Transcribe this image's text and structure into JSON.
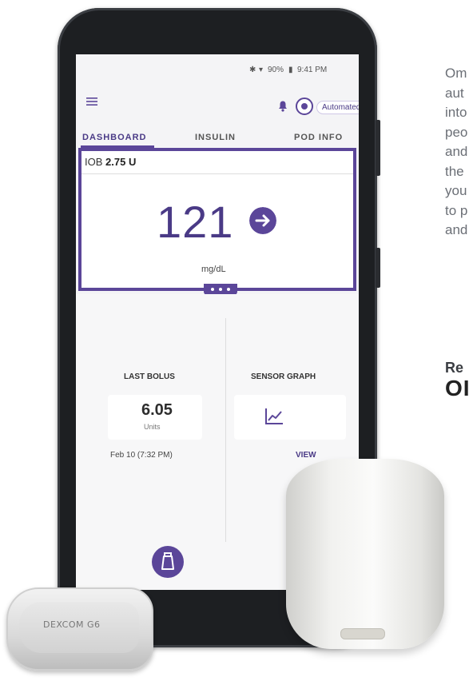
{
  "article": {
    "lines": [
      "Om",
      "aut",
      "into",
      "peo",
      "and",
      "the",
      "you",
      "to p",
      "and"
    ],
    "subheading": "Re",
    "big_heading": "OI"
  },
  "status_bar": {
    "battery": "90%",
    "time": "9:41 PM"
  },
  "app_bar": {
    "mode_label": "Automated"
  },
  "tabs": [
    {
      "label": "DASHBOARD",
      "active": true
    },
    {
      "label": "INSULIN",
      "active": false
    },
    {
      "label": "POD INFO",
      "active": false
    }
  ],
  "glucose": {
    "iob_label": "IOB",
    "iob_value": "2.75 U",
    "value": "121",
    "unit": "mg/dL",
    "trend": "right"
  },
  "last_bolus": {
    "title": "LAST BOLUS",
    "value": "6.05",
    "unit": "Units",
    "date": "Feb 10 (7:32 PM)"
  },
  "sensor_graph": {
    "title": "SENSOR GRAPH",
    "link": "VIEW"
  },
  "sensor_device": {
    "brand": "DEXCOM G6"
  },
  "colors": {
    "accent": "#5b4699",
    "accent_dark": "#4a3a86"
  },
  "icons": [
    "menu-icon",
    "bell-icon",
    "automated-ring-icon",
    "trend-arrow-icon",
    "graph-icon",
    "bolus-icon"
  ]
}
